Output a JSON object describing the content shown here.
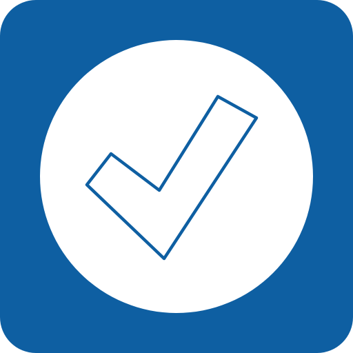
{
  "icon": {
    "name": "checkmark-app-icon",
    "glyph": "check-outline",
    "colors": {
      "tile": "#0e5fa2",
      "circle": "#ffffff",
      "check_stroke": "#0e5fa2",
      "check_fill": "#ffffff"
    }
  }
}
